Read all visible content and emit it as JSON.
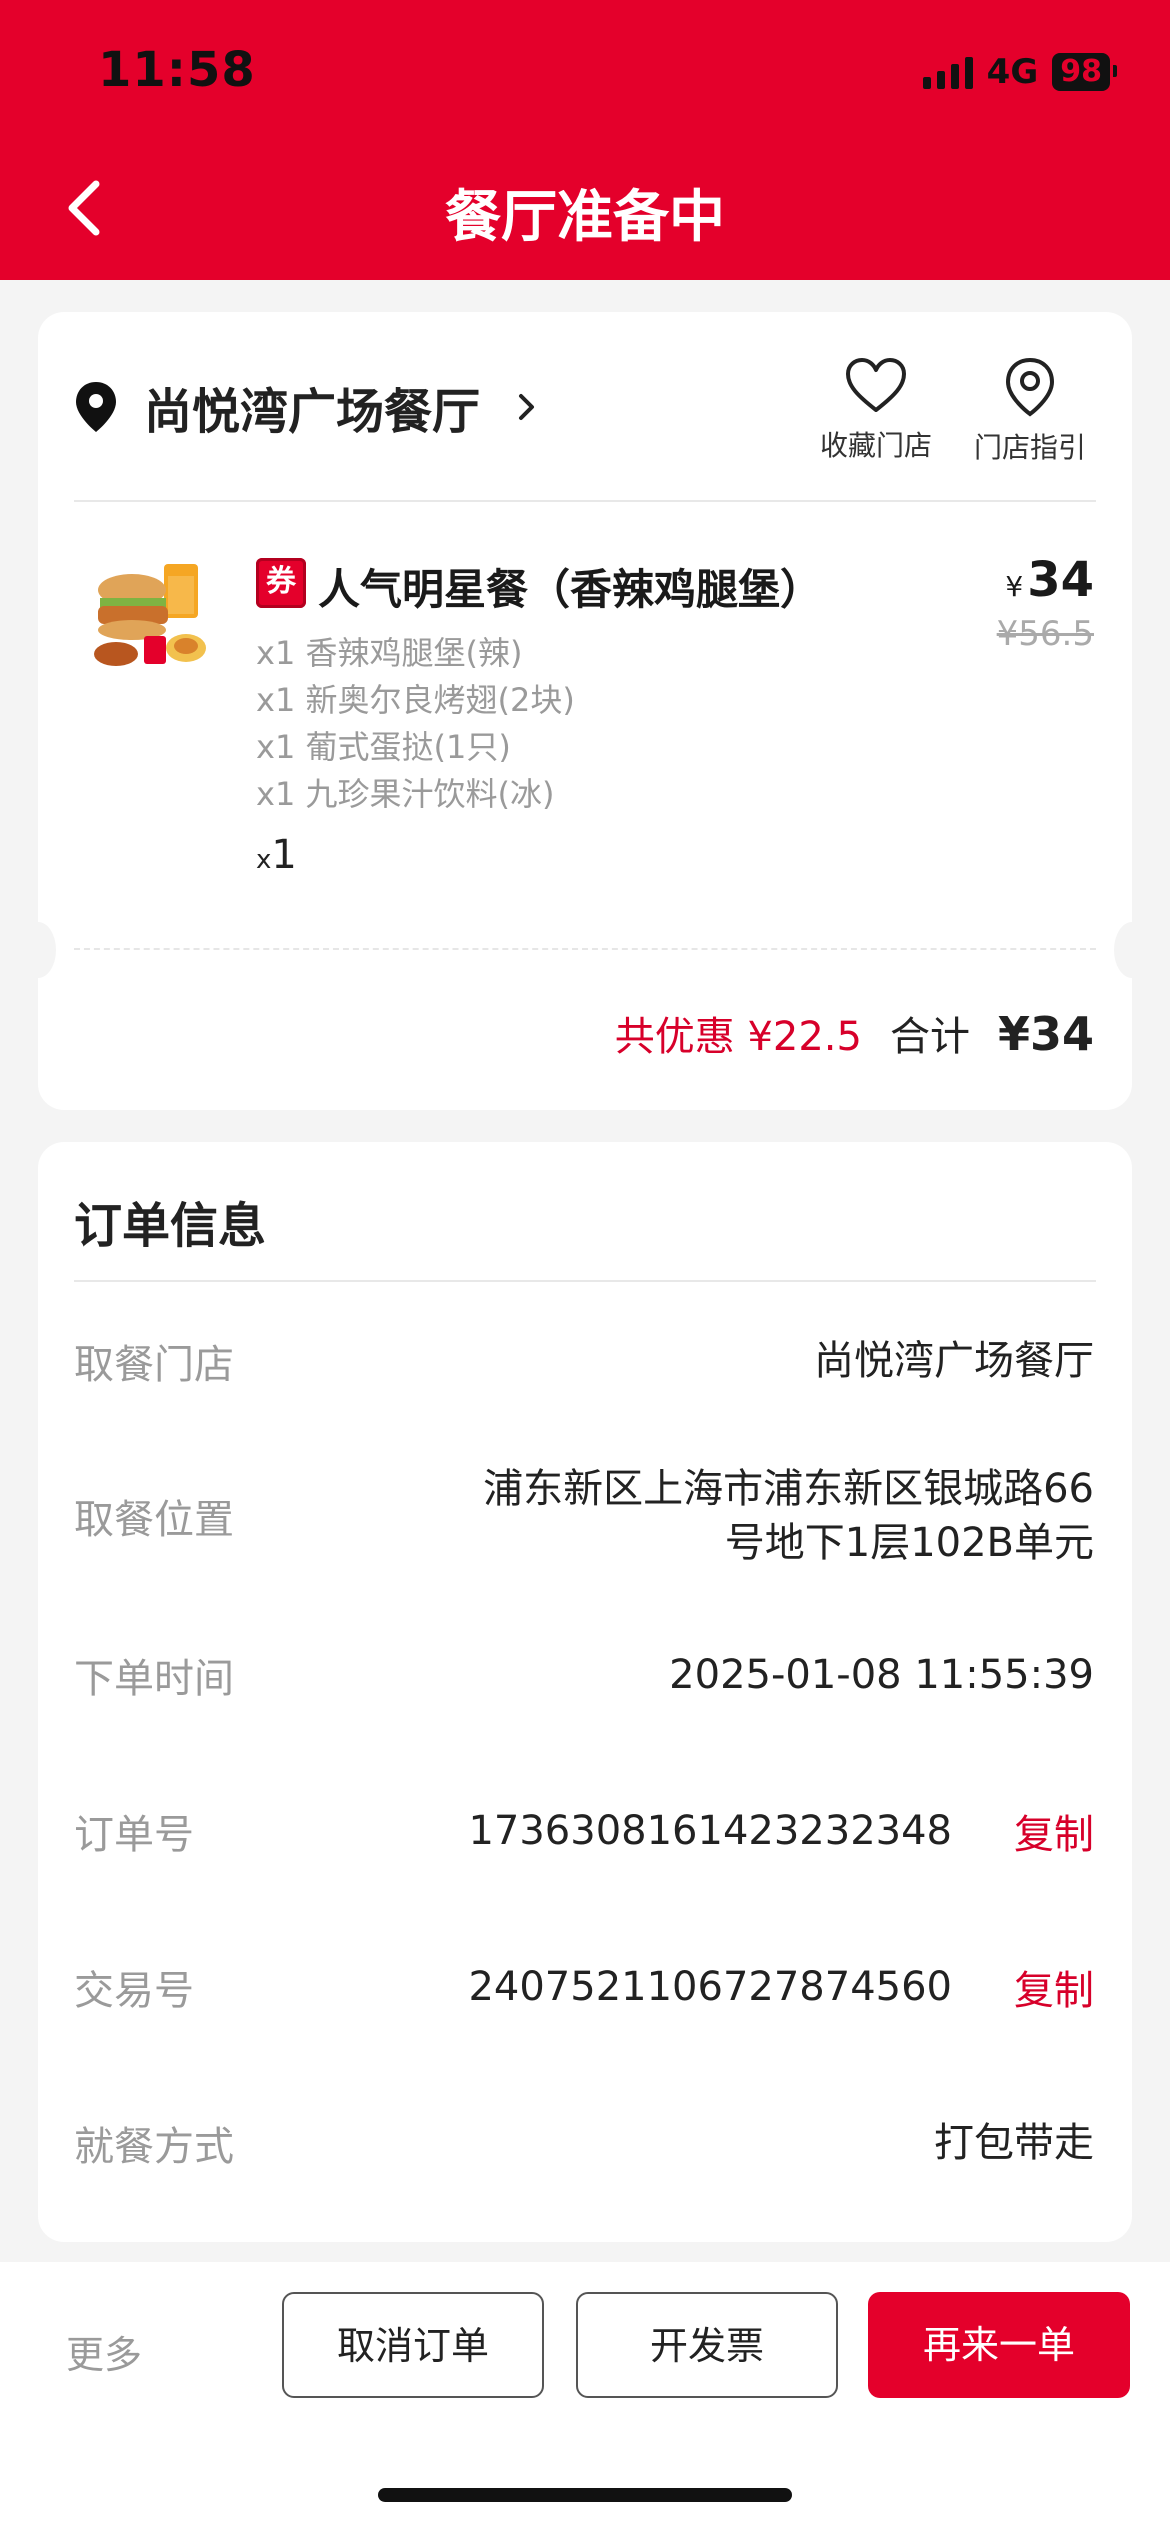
{
  "status_bar": {
    "time": "11:58",
    "network": "4G",
    "battery": "98"
  },
  "header": {
    "title": "餐厅准备中"
  },
  "store": {
    "name": "尚悦湾广场餐厅",
    "favorite_label": "收藏门店",
    "guide_label": "门店指引"
  },
  "order_item": {
    "coupon_tag": "券",
    "name": "人气明星餐（香辣鸡腿堡）",
    "price_symbol": "¥",
    "price": "34",
    "original_price": "¥56.5",
    "components": [
      "x1 香辣鸡腿堡(辣)",
      "x1 新奥尔良烤翅(2块)",
      "x1 葡式蛋挞(1只)",
      "x1 九珍果汁饮料(冰)"
    ],
    "qty_prefix": "x",
    "qty": "1"
  },
  "summary": {
    "discount": "共优惠 ¥22.5",
    "total_label": "合计",
    "total": "¥34"
  },
  "order_info": {
    "title": "订单信息",
    "rows": [
      {
        "label": "取餐门店",
        "value": "尚悦湾广场餐厅"
      },
      {
        "label": "取餐位置",
        "value_line1": "浦东新区上海市浦东新区银城路66",
        "value_line2": "号地下1层102B单元"
      },
      {
        "label": "下单时间",
        "value": "2025-01-08 11:55:39"
      },
      {
        "label": "订单号",
        "value": "1736308161423232348",
        "action": "复制"
      },
      {
        "label": "交易号",
        "value": "2407521106727874560",
        "action": "复制"
      },
      {
        "label": "就餐方式",
        "value": "打包带走"
      }
    ]
  },
  "bottom_bar": {
    "more": "更多",
    "cancel": "取消订单",
    "invoice": "开发票",
    "reorder": "再来一单"
  },
  "colors": {
    "brand": "#e4002b",
    "accent_text": "#d7002a"
  }
}
